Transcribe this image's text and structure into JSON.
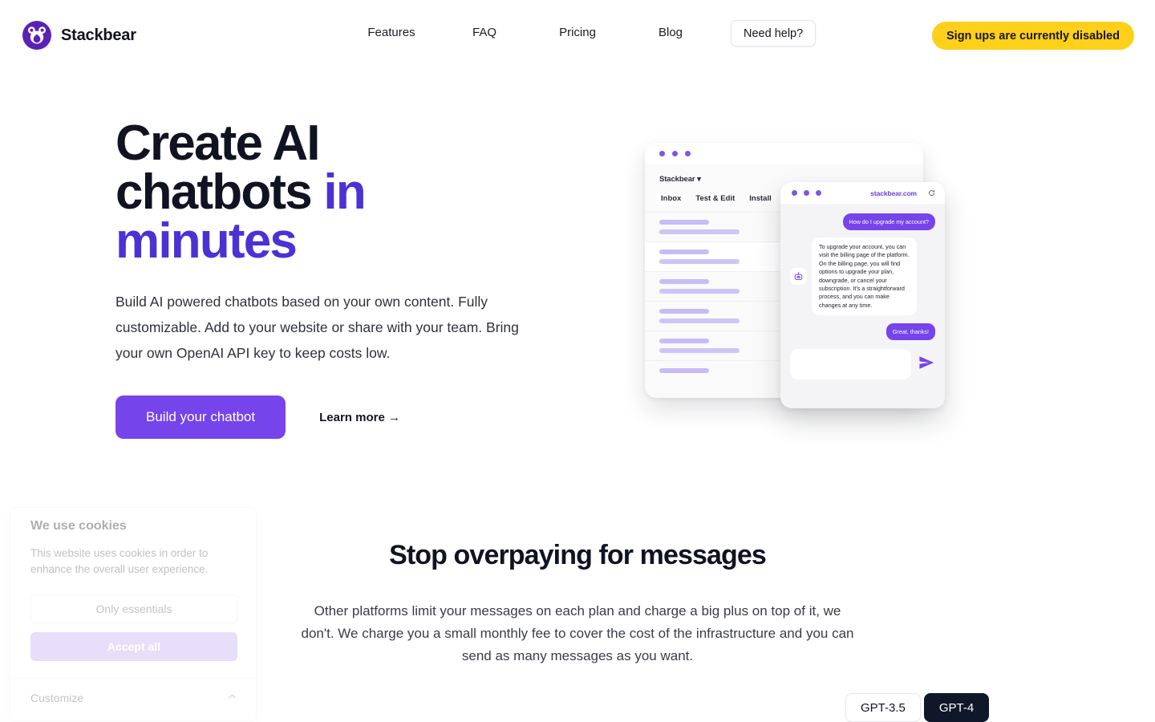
{
  "header": {
    "brand": {
      "name": "Stackbear",
      "logo_icon": "bear-logo-icon"
    },
    "nav": [
      {
        "label": "Features"
      },
      {
        "label": "FAQ"
      },
      {
        "label": "Pricing"
      },
      {
        "label": "Blog"
      }
    ],
    "help_label": "Need help?",
    "signup_label": "Sign ups are currently disabled",
    "signup_color": "#fdd019"
  },
  "hero": {
    "title_line1": "Create AI",
    "title_line2_plain": "chatbots ",
    "title_line2_accent": "in",
    "title_line3_accent": "minutes",
    "accent_color": "#4b32d4",
    "subtitle": "Build AI powered chatbots based on your own content. Fully customizable. Add to your website or share with your team. Bring your own OpenAI API key to keep costs low.",
    "cta_primary": "Build your chatbot",
    "cta_primary_color": "#7544ea",
    "cta_secondary": "Learn more →"
  },
  "illustration": {
    "back_window": {
      "brand_label": "Stackbear",
      "brand_caret": "▾",
      "tabs": [
        {
          "label": "Inbox",
          "active": true
        },
        {
          "label": "Test & Edit",
          "active": false
        },
        {
          "label": "Install",
          "active": false
        }
      ],
      "placeholder_rows": 6
    },
    "front_window": {
      "url": "stackbear.com",
      "refresh_icon": "refresh-icon",
      "bot_avatar_icon": "robot-icon",
      "messages": [
        {
          "role": "user",
          "text": "How do I upgrade my account?"
        },
        {
          "role": "bot",
          "text": "To upgrade your account, you can visit the billing page of the platform. On the billing page, you will find options to upgrade your plan, downgrade, or cancel your subscription. It's a straightforward process, and you can make changes at any time."
        },
        {
          "role": "user",
          "text": "Great, thanks!"
        }
      ],
      "composer_value": "",
      "send_icon": "send-icon"
    }
  },
  "section_pricing": {
    "title": "Stop overpaying for messages",
    "body": "Other platforms limit your messages on each plan and charge a big plus on top of it, we don't. We charge you a small monthly fee to cover the cost of the infrastructure and you can send as many messages as you want.",
    "models": [
      {
        "label": "GPT-3.5",
        "active": false
      },
      {
        "label": "GPT-4",
        "active": true
      }
    ]
  },
  "cookie_banner": {
    "title": "We use cookies",
    "body": "This website uses cookies in order to enhance the overall user experience.",
    "essentials_label": "Only essentials",
    "accept_label": "Accept all",
    "customize_label": "Customize",
    "customize_icon": "chevron-up-icon"
  }
}
